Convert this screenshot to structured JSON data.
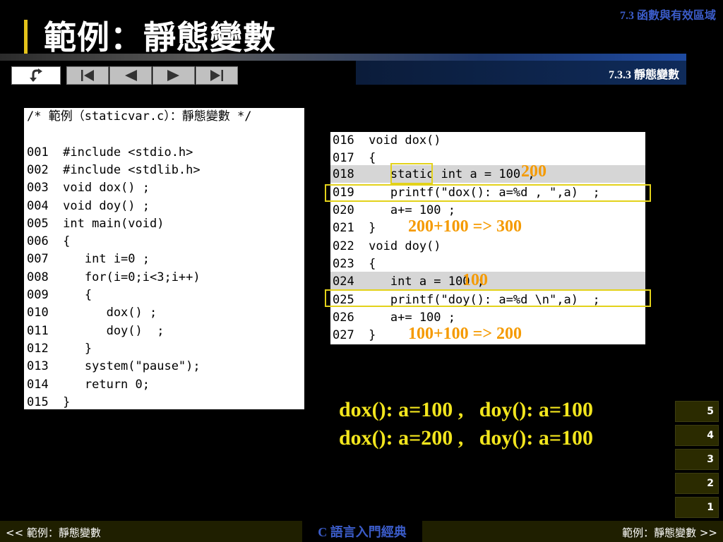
{
  "header": {
    "section_label": "7.3 函數與有效區域",
    "title": "範例：靜態變數",
    "subsection_label": "7.3.3 靜態變數"
  },
  "nav": {
    "back_icon": "return-arrow-icon",
    "first_icon": "skip-first-icon",
    "prev_icon": "triangle-left-icon",
    "next_icon": "triangle-right-icon",
    "last_icon": "skip-last-icon"
  },
  "left_code": {
    "header": "/* 範例（staticvar.c）：靜態變數 */",
    "lines": [
      "001  #include <stdio.h>",
      "002  #include <stdlib.h>",
      "003  void dox() ;",
      "004  void doy() ;",
      "005  int main(void)",
      "006  {",
      "007     int i=0 ;",
      "008     for(i=0;i<3;i++)",
      "009     {",
      "010        dox() ;",
      "011        doy()  ;",
      "012     }",
      "013     system(\"pause\");",
      "014     return 0;",
      "015  }"
    ]
  },
  "right_code": {
    "lines": [
      "016  void dox()",
      "017  {",
      "018     static int a = 100 ;",
      "019     printf(\"dox(): a=%d , \",a)  ;",
      "020     a+= 100 ;",
      "021  }",
      "022  void doy()",
      "023  {",
      "024     int a = 100 ;",
      "025     printf(\"doy(): a=%d \\n\",a)  ;",
      "026     a+= 100 ;",
      "027  }"
    ]
  },
  "annotations": {
    "dox_value": "200",
    "dox_calc": "200+100 => 300",
    "doy_value": "100",
    "doy_calc": "100+100 => 200"
  },
  "results": {
    "line1": "dox(): a=100 ,   doy(): a=100",
    "line2": "dox(): a=200 ,   doy(): a=100"
  },
  "pages": [
    "5",
    "4",
    "3",
    "2",
    "1"
  ],
  "footer": {
    "prev_label": "<< 範例：靜態變數",
    "book_title": "C 語言入門經典",
    "next_label": "範例：靜態變數 >>"
  },
  "colors": {
    "accent_gold": "#e3c21a",
    "annotation_orange": "#f59a00",
    "result_yellow": "#f2e51d",
    "brand_blue": "#3b5cc9"
  }
}
